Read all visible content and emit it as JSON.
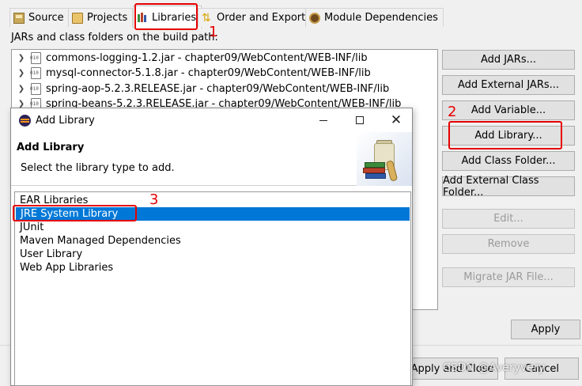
{
  "tabs": [
    {
      "label": "Source",
      "icon": "source-folder-icon"
    },
    {
      "label": "Projects",
      "icon": "project-folder-icon"
    },
    {
      "label": "Libraries",
      "icon": "libraries-icon",
      "active": true
    },
    {
      "label": "Order and Export",
      "icon": "order-export-icon"
    },
    {
      "label": "Module Dependencies",
      "icon": "module-dependencies-icon"
    }
  ],
  "build_path_label": "JARs and class folders on the build path:",
  "jars": [
    "commons-logging-1.2.jar - chapter09/WebContent/WEB-INF/lib",
    "mysql-connector-5.1.8.jar - chapter09/WebContent/WEB-INF/lib",
    "spring-aop-5.2.3.RELEASE.jar - chapter09/WebContent/WEB-INF/lib",
    "spring-beans-5.2.3.RELEASE.jar - chapter09/WebContent/WEB-INF/lib"
  ],
  "buttons": {
    "add_jars": "Add JARs...",
    "add_external_jars": "Add External JARs...",
    "add_variable": "Add Variable...",
    "add_library": "Add Library...",
    "add_class_folder": "Add Class Folder...",
    "add_external_class_folder": "Add External Class Folder...",
    "edit": "Edit...",
    "remove": "Remove",
    "migrate": "Migrate JAR File...",
    "apply": "Apply",
    "apply_close": "Apply and Close",
    "cancel": "Cancel"
  },
  "dialog": {
    "title": "Add Library",
    "header_title": "Add Library",
    "description": "Select the library type to add.",
    "libraries": [
      "EAR Libraries",
      "JRE System Library",
      "JUnit",
      "Maven Managed Dependencies",
      "User Library",
      "Web App Libraries"
    ],
    "selected": "JRE System Library"
  },
  "annotations": {
    "step1": "1",
    "step2": "2",
    "step3": "3",
    "color": "#e60000"
  },
  "watermark": "CSDN @Averyvery",
  "colors": {
    "selection": "#0078d7",
    "background": "#f0f0f0"
  }
}
